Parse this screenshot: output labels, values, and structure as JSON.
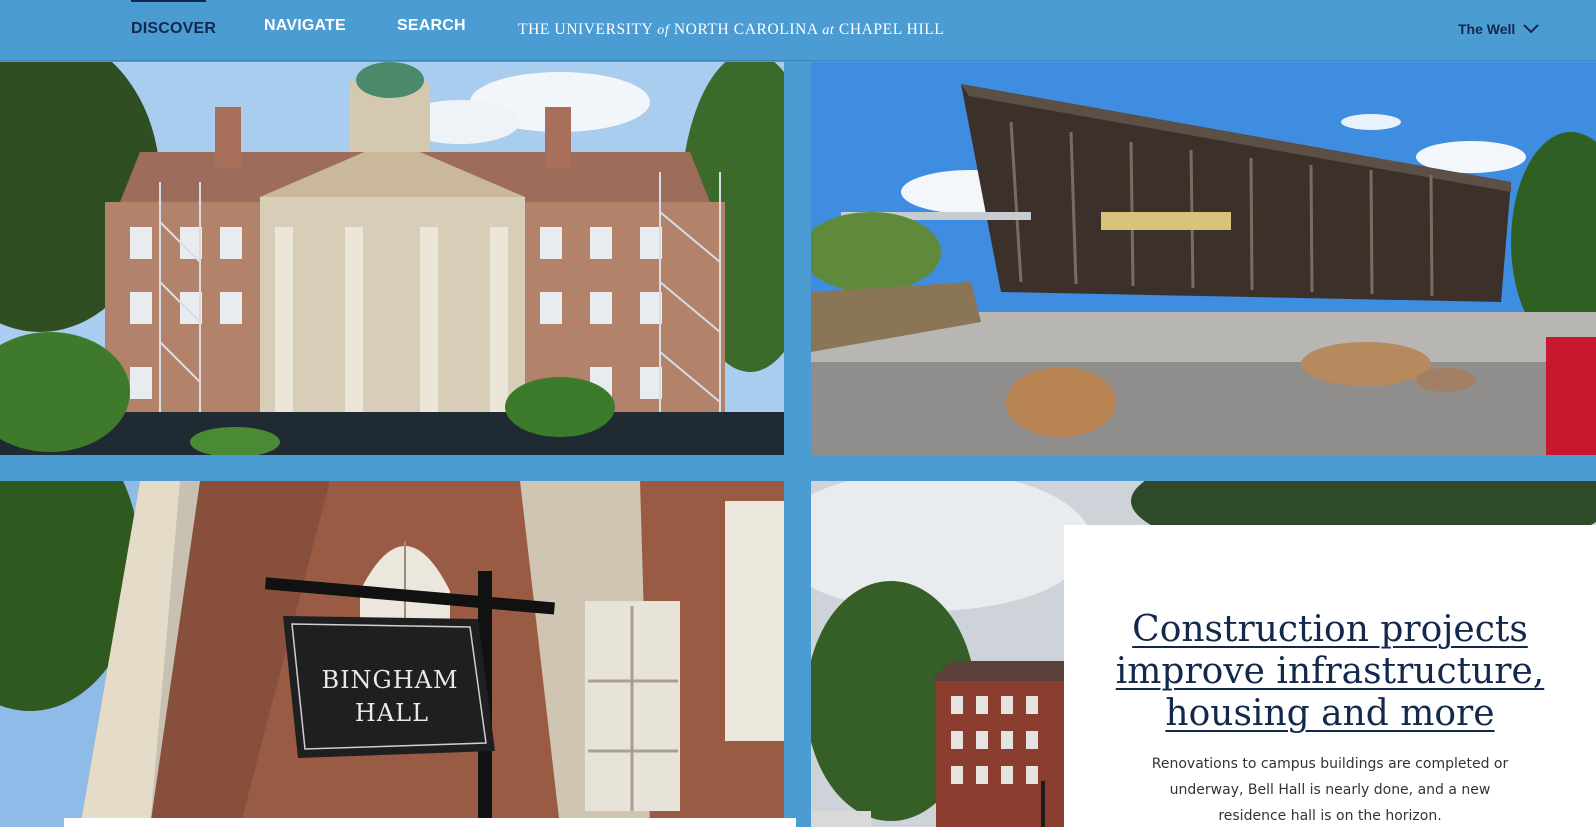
{
  "header": {
    "nav": [
      {
        "label": "DISCOVER",
        "active": true
      },
      {
        "label": "NAVIGATE",
        "active": false
      },
      {
        "label": "SEARCH",
        "active": false
      }
    ],
    "brand": {
      "part1": "THE UNIVERSITY ",
      "of": "of",
      "part2": " NORTH CAROLINA ",
      "at": "at",
      "part3": " CHAPEL HILL"
    },
    "site_menu": {
      "label": "The Well",
      "icon": "chevron-down-icon"
    }
  },
  "tiles": [
    {
      "description": "photo-building-scaffolding"
    },
    {
      "description": "photo-modern-building-plaza"
    },
    {
      "description": "photo-bingham-hall",
      "sign_line1": "BINGHAM",
      "sign_line2": "HALL"
    },
    {
      "description": "photo-residence-hall"
    }
  ],
  "feature": {
    "title": "Construction projects improve infrastructure, housing and more",
    "description": "Renovations to campus buildings are completed or underway, Bell Hall is nearly done, and a new residence hall is on the horizon."
  },
  "colors": {
    "carolina_blue": "#4b9cd3",
    "navy": "#13294b",
    "white": "#ffffff"
  }
}
